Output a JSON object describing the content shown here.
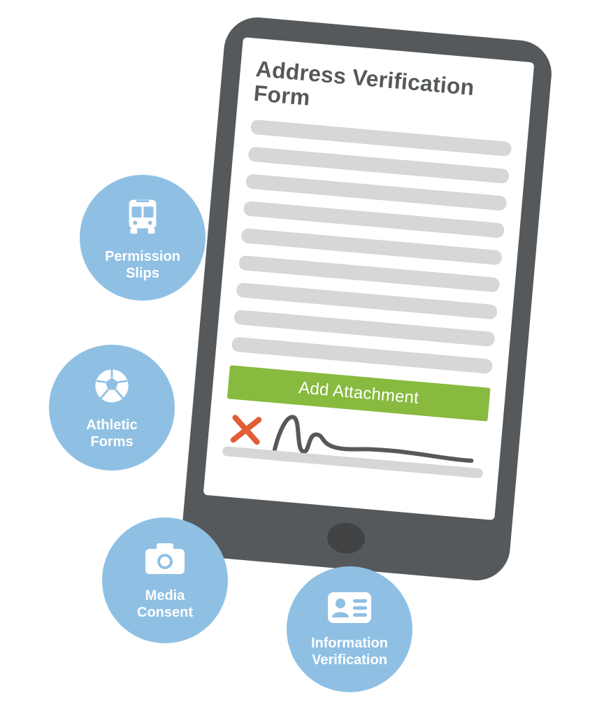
{
  "phone": {
    "form_title": "Address Verification Form",
    "attachment_button": "Add Attachment"
  },
  "categories": {
    "permission": {
      "line1": "Permission",
      "line2": "Slips"
    },
    "athletic": {
      "line1": "Athletic",
      "line2": "Forms"
    },
    "media": {
      "line1": "Media",
      "line2": "Consent"
    },
    "info": {
      "line1": "Information",
      "line2": "Verification"
    }
  },
  "colors": {
    "circle": "#8FC0E4",
    "button": "#87BA3F",
    "phone": "#56595B",
    "placeholder": "#D5D7D8",
    "x_mark": "#E25C35",
    "signature": "#56595B"
  }
}
